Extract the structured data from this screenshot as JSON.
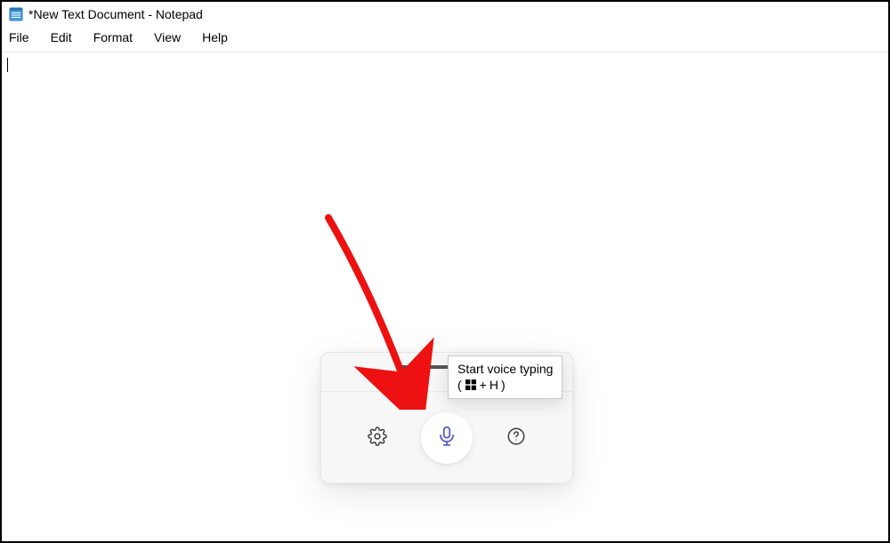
{
  "window": {
    "title": "*New Text Document - Notepad"
  },
  "menu": {
    "items": [
      "File",
      "Edit",
      "Format",
      "View",
      "Help"
    ]
  },
  "editor": {
    "content": ""
  },
  "voice_panel": {
    "settings_icon": "gear-icon",
    "mic_icon": "microphone-icon",
    "help_icon": "help-icon"
  },
  "tooltip": {
    "line1": "Start voice typing",
    "prefix": "(",
    "plus": " + ",
    "key": "H",
    "suffix": ")"
  }
}
